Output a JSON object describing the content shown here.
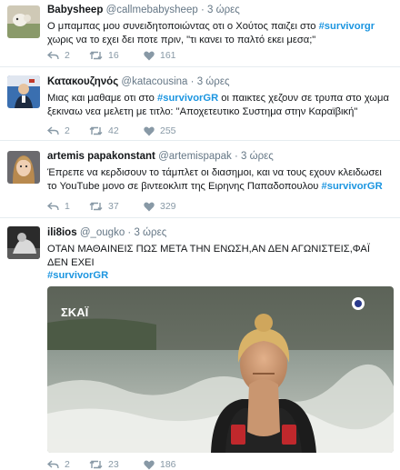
{
  "tweets": [
    {
      "name": "Babysheep",
      "handle": "@callmebabysheep",
      "sep": "·",
      "time": "3 ώρες",
      "text_before": "Ο μπαμπας μου συνειδητοποιώντας οτι ο Χούτος παιζει στο ",
      "hashtag": "#survivorgr",
      "text_after": " χωρις να το εχει δει ποτε πριν, \"τι κανει το παλτό εκει μεσα;\"",
      "replies": "2",
      "retweets": "16",
      "likes": "161"
    },
    {
      "name": "Κατακουζηνός",
      "handle": "@katacousina",
      "sep": "·",
      "time": "3 ώρες",
      "text_before": "Μιας και μαθαμε οτι στο ",
      "hashtag": "#survivorGR",
      "text_after": " οι παικτες χεζουν σε τρυπα στο χωμα ξεκιναω νεα μελετη με τιτλο: \"Αποχετευτικο Συστημα στην Καραϊβική\"",
      "replies": "2",
      "retweets": "42",
      "likes": "255"
    },
    {
      "name": "artemis papakonstant",
      "handle": "@artemispapak",
      "sep": "·",
      "time": "3 ώρες",
      "text_before": "Έπρεπε να κερδισουν το τάμπλετ οι διασημοι, και να τους εχουν κλειδωσει το YouTube μονο σε βιντεοκλιπ της Ειρηνης Παπαδοπουλου ",
      "hashtag": "#survivorGR",
      "text_after": "",
      "replies": "1",
      "retweets": "37",
      "likes": "329"
    },
    {
      "name": "ili8ios",
      "handle": "@_ougko",
      "sep": "·",
      "time": "3 ώρες",
      "text_before": "ΟΤΑΝ ΜΑΘΑΙΝΕΙΣ ΠΩΣ ΜΕΤΑ ΤΗΝ ΕΝΩΣΗ,ΑΝ ΔΕΝ ΑΓΩΝΙΣΤΕΙΣ,ΦΑΪ ΔΕΝ ΕΧΕΙ",
      "hashtag": "#survivorGR",
      "text_after": "",
      "replies": "2",
      "retweets": "23",
      "likes": "186",
      "media_logo": "ΣΚΑΪ"
    }
  ],
  "colors": {
    "hashtag": "#1b95e0",
    "action": "#8899a6",
    "divider": "#e6ecf0"
  },
  "icons": [
    "reply-icon",
    "retweet-icon",
    "like-icon",
    "broadcast-dot-icon"
  ]
}
